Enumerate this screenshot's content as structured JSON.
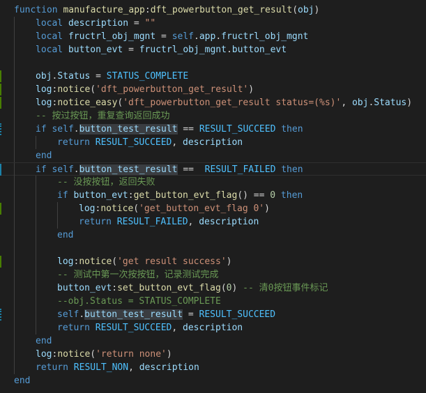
{
  "editor": {
    "language": "lua",
    "colors": {
      "background": "#1e1e1e",
      "keyword": "#569cd6",
      "function": "#dcdcaa",
      "variable": "#9cdcfe",
      "constant": "#4fc1ff",
      "string": "#ce9178",
      "number": "#b5cea8",
      "comment": "#6a9955",
      "gutter_modified": "#1b81a8",
      "gutter_added": "#487e02"
    },
    "lines": [
      {
        "indent": 0,
        "gutter": "",
        "tokens": [
          [
            "kw",
            "function "
          ],
          [
            "fn",
            "manufacture_app"
          ],
          [
            "op",
            ":"
          ],
          [
            "fn",
            "dft_powerbutton_get_result"
          ],
          [
            "op",
            "("
          ],
          [
            "var",
            "obj"
          ],
          [
            "op",
            ")"
          ]
        ]
      },
      {
        "indent": 1,
        "gutter": "",
        "tokens": [
          [
            "kw",
            "local "
          ],
          [
            "var",
            "description"
          ],
          [
            "op",
            " = "
          ],
          [
            "str",
            "\"\""
          ]
        ]
      },
      {
        "indent": 1,
        "gutter": "",
        "tokens": [
          [
            "kw",
            "local "
          ],
          [
            "var",
            "fructrl_obj_mgnt"
          ],
          [
            "op",
            " = "
          ],
          [
            "kw",
            "self"
          ],
          [
            "op",
            "."
          ],
          [
            "var",
            "app"
          ],
          [
            "op",
            "."
          ],
          [
            "var",
            "fructrl_obj_mgnt"
          ]
        ]
      },
      {
        "indent": 1,
        "gutter": "",
        "tokens": [
          [
            "kw",
            "local "
          ],
          [
            "var",
            "button_evt"
          ],
          [
            "op",
            " = "
          ],
          [
            "var",
            "fructrl_obj_mgnt"
          ],
          [
            "op",
            "."
          ],
          [
            "var",
            "button_evt"
          ]
        ]
      },
      {
        "indent": 1,
        "gutter": "",
        "tokens": []
      },
      {
        "indent": 1,
        "gutter": "add",
        "tokens": [
          [
            "var",
            "obj"
          ],
          [
            "op",
            "."
          ],
          [
            "var",
            "Status"
          ],
          [
            "op",
            " = "
          ],
          [
            "const",
            "STATUS_COMPLETE"
          ]
        ]
      },
      {
        "indent": 1,
        "gutter": "add",
        "tokens": [
          [
            "var",
            "log"
          ],
          [
            "op",
            ":"
          ],
          [
            "fn",
            "notice"
          ],
          [
            "op",
            "("
          ],
          [
            "str",
            "'dft_powerbutton_get_result'"
          ],
          [
            "op",
            ")"
          ]
        ]
      },
      {
        "indent": 1,
        "gutter": "add",
        "tokens": [
          [
            "var",
            "log"
          ],
          [
            "op",
            ":"
          ],
          [
            "fn",
            "notice_easy"
          ],
          [
            "op",
            "("
          ],
          [
            "str",
            "'dft_powerbutton_get_result status=(%s)'"
          ],
          [
            "op",
            ", "
          ],
          [
            "var",
            "obj"
          ],
          [
            "op",
            "."
          ],
          [
            "var",
            "Status"
          ],
          [
            "op",
            ")"
          ]
        ]
      },
      {
        "indent": 1,
        "gutter": "",
        "tokens": [
          [
            "cm",
            "-- 按过按钮，重复查询返回成功"
          ]
        ]
      },
      {
        "indent": 1,
        "gutter": "dot",
        "tokens": [
          [
            "kw",
            "if "
          ],
          [
            "kw",
            "self"
          ],
          [
            "op",
            "."
          ],
          [
            "hl",
            "button_test_result"
          ],
          [
            "op",
            " == "
          ],
          [
            "const",
            "RESULT_SUCCEED"
          ],
          [
            "kw",
            " then"
          ]
        ]
      },
      {
        "indent": 2,
        "gutter": "",
        "tokens": [
          [
            "kw",
            "return "
          ],
          [
            "const",
            "RESULT_SUCCEED"
          ],
          [
            "op",
            ", "
          ],
          [
            "var",
            "description"
          ]
        ]
      },
      {
        "indent": 1,
        "gutter": "",
        "tokens": [
          [
            "kw",
            "end"
          ]
        ]
      },
      {
        "indent": 1,
        "gutter": "mod",
        "current": true,
        "tokens": [
          [
            "kw",
            "if "
          ],
          [
            "kw",
            "self"
          ],
          [
            "op",
            "."
          ],
          [
            "hl",
            "button_test_result"
          ],
          [
            "op",
            " ==  "
          ],
          [
            "const",
            "RESULT_FAILED"
          ],
          [
            "kw",
            " then"
          ]
        ]
      },
      {
        "indent": 2,
        "gutter": "",
        "tokens": [
          [
            "cm",
            "-- 没按按钮，返回失败"
          ]
        ]
      },
      {
        "indent": 2,
        "gutter": "",
        "tokens": [
          [
            "kw",
            "if "
          ],
          [
            "var",
            "button_evt"
          ],
          [
            "op",
            ":"
          ],
          [
            "fn",
            "get_button_evt_flag"
          ],
          [
            "op",
            "() == "
          ],
          [
            "num",
            "0"
          ],
          [
            "kw",
            " then"
          ]
        ]
      },
      {
        "indent": 3,
        "gutter": "add",
        "tokens": [
          [
            "var",
            "log"
          ],
          [
            "op",
            ":"
          ],
          [
            "fn",
            "notice"
          ],
          [
            "op",
            "("
          ],
          [
            "str",
            "'get_button_evt_flag 0'"
          ],
          [
            "op",
            ")"
          ]
        ]
      },
      {
        "indent": 3,
        "gutter": "",
        "tokens": [
          [
            "kw",
            "return "
          ],
          [
            "const",
            "RESULT_FAILED"
          ],
          [
            "op",
            ", "
          ],
          [
            "var",
            "description"
          ]
        ]
      },
      {
        "indent": 2,
        "gutter": "",
        "tokens": [
          [
            "kw",
            "end"
          ]
        ]
      },
      {
        "indent": 2,
        "gutter": "",
        "tokens": []
      },
      {
        "indent": 2,
        "gutter": "add",
        "tokens": [
          [
            "var",
            "log"
          ],
          [
            "op",
            ":"
          ],
          [
            "fn",
            "notice"
          ],
          [
            "op",
            "("
          ],
          [
            "str",
            "'get result success'"
          ],
          [
            "op",
            ")"
          ]
        ]
      },
      {
        "indent": 2,
        "gutter": "",
        "tokens": [
          [
            "cm",
            "-- 测试中第一次按按钮，记录测试完成"
          ]
        ]
      },
      {
        "indent": 2,
        "gutter": "",
        "tokens": [
          [
            "var",
            "button_evt"
          ],
          [
            "op",
            ":"
          ],
          [
            "fn",
            "set_button_evt_flag"
          ],
          [
            "op",
            "("
          ],
          [
            "num",
            "0"
          ],
          [
            "op",
            ") "
          ],
          [
            "cm",
            "-- 清0按钮事件标记"
          ]
        ]
      },
      {
        "indent": 2,
        "gutter": "",
        "tokens": [
          [
            "cm",
            "--obj.Status = STATUS_COMPLETE"
          ]
        ]
      },
      {
        "indent": 2,
        "gutter": "dot",
        "tokens": [
          [
            "kw",
            "self"
          ],
          [
            "op",
            "."
          ],
          [
            "hl",
            "button_test_result"
          ],
          [
            "op",
            " = "
          ],
          [
            "const",
            "RESULT_SUCCEED"
          ]
        ]
      },
      {
        "indent": 2,
        "gutter": "",
        "tokens": [
          [
            "kw",
            "return "
          ],
          [
            "const",
            "RESULT_SUCCEED"
          ],
          [
            "op",
            ", "
          ],
          [
            "var",
            "description"
          ]
        ]
      },
      {
        "indent": 1,
        "gutter": "",
        "tokens": [
          [
            "kw",
            "end"
          ]
        ]
      },
      {
        "indent": 1,
        "gutter": "",
        "tokens": [
          [
            "var",
            "log"
          ],
          [
            "op",
            ":"
          ],
          [
            "fn",
            "notice"
          ],
          [
            "op",
            "("
          ],
          [
            "str",
            "'return none'"
          ],
          [
            "op",
            ")"
          ]
        ]
      },
      {
        "indent": 1,
        "gutter": "",
        "tokens": [
          [
            "kw",
            "return "
          ],
          [
            "const",
            "RESULT_NON"
          ],
          [
            "op",
            ", "
          ],
          [
            "var",
            "description"
          ]
        ]
      },
      {
        "indent": 0,
        "gutter": "",
        "tokens": [
          [
            "kw",
            "end"
          ]
        ]
      }
    ]
  }
}
